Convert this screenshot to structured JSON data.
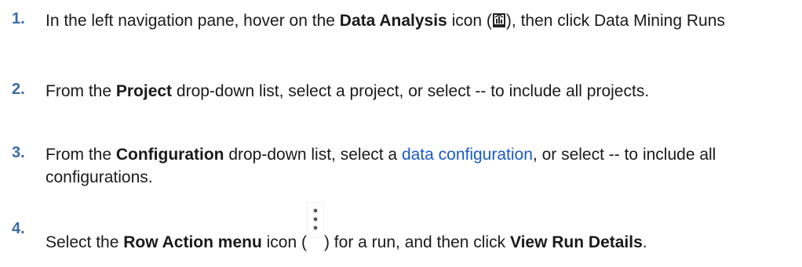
{
  "steps": [
    {
      "number": "1.",
      "t1": "In the left navigation pane, hover on the ",
      "b1": "Data Analysis",
      "t2": " icon (",
      "icon": "data-analysis-icon",
      "t3": "), then click Data Mining Runs"
    },
    {
      "number": "2.",
      "t1": "From the ",
      "b1": "Project",
      "t2": " drop-down list, select a project, or select -- to include all projects."
    },
    {
      "number": "3.",
      "t1": "From the ",
      "b1": "Configuration",
      "t2": " drop-down list, select a ",
      "link": "data configuration",
      "t3": ", or select -- to include all configurations."
    },
    {
      "number": "4.",
      "t1": "Select the ",
      "b1": "Row Action menu",
      "t2": " icon (",
      "icon": "row-action-menu-icon",
      "t3": ") for a run, and then click ",
      "b2": "View Run Details",
      "t4": "."
    }
  ],
  "colors": {
    "step_number": "#3b6aa8",
    "link": "#1a5bc2",
    "text": "#1a1a1a"
  }
}
